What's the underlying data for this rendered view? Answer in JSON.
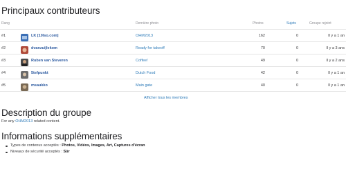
{
  "sections": {
    "contributors_title": "Principaux contributeurs",
    "description_title": "Description du groupe",
    "info_title": "Informations supplémentaires"
  },
  "table": {
    "headers": {
      "rank": "Rang",
      "photo": "Dernière photo",
      "photos": "Photos",
      "sujets": "Sujets",
      "joined": "Groupe rejoint"
    },
    "rows": [
      {
        "rank": "#1",
        "user": "LK [10lso.com]",
        "photo": "OHM2013",
        "photos": "162",
        "sujets": "0",
        "joined": "Il y a 1 an",
        "avatar_color": "#3b6fb6"
      },
      {
        "rank": "#2",
        "user": "dvanzuijlekom",
        "photo": "Ready for takeoff",
        "photos": "70",
        "sujets": "0",
        "joined": "Il y a 3 ans",
        "avatar_color": "#b04a3a"
      },
      {
        "rank": "#3",
        "user": "Ruben van Steveren",
        "photo": "Coffee!",
        "photos": "49",
        "sujets": "0",
        "joined": "Il y a 2 ans",
        "avatar_color": "#4a4a4a"
      },
      {
        "rank": "#4",
        "user": "5tefpunkt",
        "photo": "Dutch Food",
        "photos": "42",
        "sujets": "0",
        "joined": "Il y a 1 an",
        "avatar_color": "#6b6b6b"
      },
      {
        "rank": "#5",
        "user": "msaukko",
        "photo": "Main gate",
        "photos": "40",
        "sujets": "0",
        "joined": "Il y a 1 an",
        "avatar_color": "#7a6a55"
      }
    ],
    "show_all": "Afficher tous les membres"
  },
  "description": {
    "prefix": "For any ",
    "link": "OHM2013",
    "suffix": " related content."
  },
  "info": {
    "content_types_label": "Types de contenus acceptés : ",
    "content_types_value": "Photos, Vidéos, Images, Art, Captures d'écran",
    "safety_label": "Niveaux de sécurité acceptés : ",
    "safety_value": "Sûr"
  }
}
